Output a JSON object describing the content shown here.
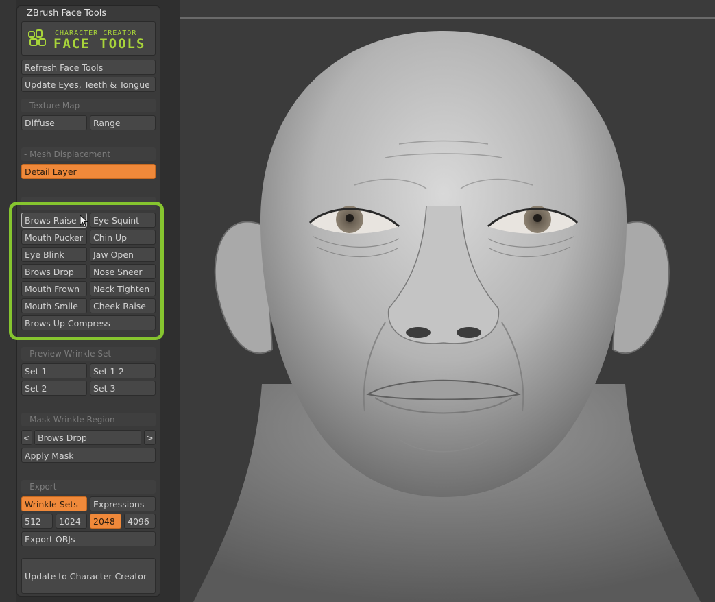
{
  "panel": {
    "title": "ZBrush Face Tools",
    "logo": {
      "small_text": "CHARACTER CREATOR",
      "big_text": "FACE TOOLS",
      "icon": "face-tools-logo-icon",
      "color": "#a8d43a"
    },
    "refresh_label": "Refresh Face Tools",
    "update_eyes_label": "Update Eyes, Teeth & Tongue",
    "texture_map": {
      "header": "- Texture Map",
      "diffuse_label": "Diffuse",
      "range_label": "Range"
    },
    "mesh_displacement": {
      "header": "- Mesh Displacement",
      "detail_layer_label": "Detail Layer"
    },
    "expressions": {
      "brows_raise": "Brows Raise",
      "eye_squint": "Eye Squint",
      "mouth_pucker": "Mouth Pucker",
      "chin_up": "Chin Up",
      "eye_blink": "Eye Blink",
      "jaw_open": "Jaw Open",
      "brows_drop": "Brows Drop",
      "nose_sneer": "Nose Sneer",
      "mouth_frown": "Mouth Frown",
      "neck_tighten": "Neck Tighten",
      "mouth_smile": "Mouth Smile",
      "cheek_raise": "Cheek Raise",
      "brows_up_compress": "Brows Up Compress"
    },
    "preview_wrinkle_set": {
      "header": "- Preview Wrinkle Set",
      "set1": "Set 1",
      "set12": "Set 1-2",
      "set2": "Set 2",
      "set3": "Set 3"
    },
    "mask_wrinkle_region": {
      "header": "- Mask Wrinkle Region",
      "prev": "<",
      "selected": "Brows Drop",
      "next": ">",
      "apply_label": "Apply Mask"
    },
    "export": {
      "header": "- Export",
      "wrinkle_sets_label": "Wrinkle Sets",
      "expressions_label": "Expressions",
      "res_512": "512",
      "res_1024": "1024",
      "res_2048": "2048",
      "res_4096": "4096",
      "export_objs_label": "Export OBJs"
    },
    "update_cc_label": "Update to Character Creator"
  },
  "colors": {
    "accent_orange": "#f0893a",
    "highlight_green": "#86c52f",
    "panel_bg": "#3a3a3a"
  }
}
